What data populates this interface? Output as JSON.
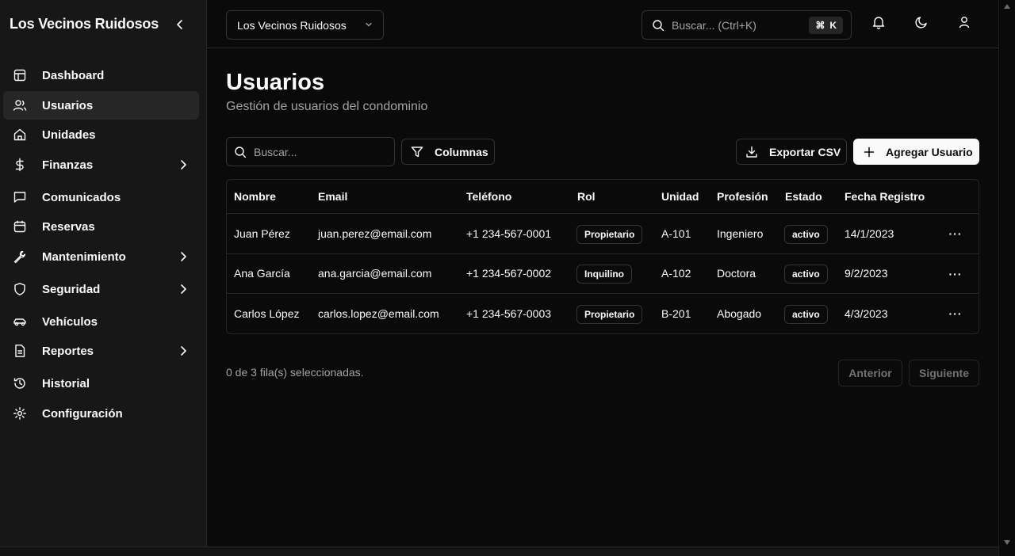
{
  "brand": {
    "name": "Los Vecinos Ruidosos"
  },
  "sidebar": {
    "items": [
      {
        "label": "Dashboard",
        "icon": "dashboard-icon",
        "has_submenu": false,
        "active": false
      },
      {
        "label": "Usuarios",
        "icon": "users-icon",
        "has_submenu": false,
        "active": true
      },
      {
        "label": "Unidades",
        "icon": "home-icon",
        "has_submenu": false,
        "active": false
      },
      {
        "label": "Finanzas",
        "icon": "dollar-icon",
        "has_submenu": true,
        "active": false
      },
      {
        "label": "Comunicados",
        "icon": "message-icon",
        "has_submenu": false,
        "active": false
      },
      {
        "label": "Reservas",
        "icon": "calendar-icon",
        "has_submenu": false,
        "active": false
      },
      {
        "label": "Mantenimiento",
        "icon": "wrench-icon",
        "has_submenu": true,
        "active": false
      },
      {
        "label": "Seguridad",
        "icon": "shield-icon",
        "has_submenu": true,
        "active": false
      },
      {
        "label": "Vehículos",
        "icon": "car-icon",
        "has_submenu": false,
        "active": false
      },
      {
        "label": "Reportes",
        "icon": "file-icon",
        "has_submenu": true,
        "active": false
      },
      {
        "label": "Historial",
        "icon": "history-icon",
        "has_submenu": false,
        "active": false
      },
      {
        "label": "Configuración",
        "icon": "gear-icon",
        "has_submenu": false,
        "active": false
      }
    ]
  },
  "topbar": {
    "org_select_value": "Los Vecinos Ruidosos",
    "search_placeholder": "Buscar... (Ctrl+K)",
    "shortcut_symbol": "⌘",
    "shortcut_key": "K"
  },
  "page": {
    "title": "Usuarios",
    "subtitle": "Gestión de usuarios del condominio"
  },
  "toolbar": {
    "filter_placeholder": "Buscar...",
    "columns_label": "Columnas",
    "export_label": "Exportar CSV",
    "add_label": "Agregar Usuario"
  },
  "table": {
    "headers": [
      "Nombre",
      "Email",
      "Teléfono",
      "Rol",
      "Unidad",
      "Profesión",
      "Estado",
      "Fecha Registro"
    ],
    "rows": [
      {
        "nombre": "Juan Pérez",
        "email": "juan.perez@email.com",
        "telefono": "+1 234-567-0001",
        "rol": "Propietario",
        "unidad": "A-101",
        "profesion": "Ingeniero",
        "estado": "activo",
        "fecha": "14/1/2023"
      },
      {
        "nombre": "Ana García",
        "email": "ana.garcia@email.com",
        "telefono": "+1 234-567-0002",
        "rol": "Inquilino",
        "unidad": "A-102",
        "profesion": "Doctora",
        "estado": "activo",
        "fecha": "9/2/2023"
      },
      {
        "nombre": "Carlos López",
        "email": "carlos.lopez@email.com",
        "telefono": "+1 234-567-0003",
        "rol": "Propietario",
        "unidad": "B-201",
        "profesion": "Abogado",
        "estado": "activo",
        "fecha": "4/3/2023"
      }
    ],
    "row_actions_label": "···"
  },
  "footer": {
    "selection_text": "0 de 3 fila(s) seleccionadas.",
    "prev_label": "Anterior",
    "next_label": "Siguiente"
  }
}
